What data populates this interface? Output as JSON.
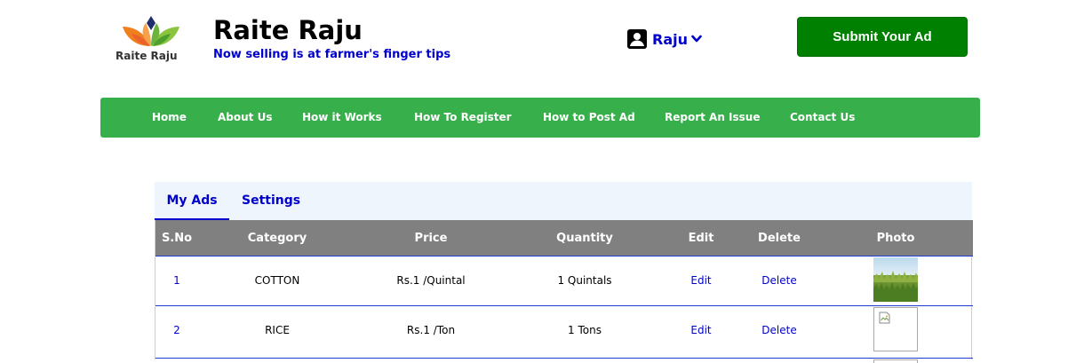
{
  "header": {
    "logo_text": "Raite Raju",
    "site_title": "Raite Raju",
    "tagline": "Now selling is at farmer's finger tips",
    "user_name": "Raju",
    "submit_label": "Submit Your Ad"
  },
  "nav": {
    "items": [
      "Home",
      "About Us",
      "How it Works",
      "How To Register",
      "How to Post Ad",
      "Report An Issue",
      "Contact Us"
    ]
  },
  "tabs": [
    "My Ads",
    "Settings"
  ],
  "table": {
    "headers": [
      "S.No",
      "Category",
      "Price",
      "Quantity",
      "Edit",
      "Delete",
      "Photo"
    ],
    "rows": [
      {
        "sno": "1",
        "category": "COTTON",
        "price": "Rs.1 /Quintal",
        "quantity": "1 Quintals",
        "edit": "Edit",
        "delete": "Delete",
        "photo": "crop-photo"
      },
      {
        "sno": "2",
        "category": "RICE",
        "price": "Rs.1 /Ton",
        "quantity": "1 Tons",
        "edit": "Edit",
        "delete": "Delete",
        "photo": "broken-image-icon"
      }
    ]
  },
  "colors": {
    "nav_green": "#37b04b",
    "button_green": "#008000",
    "link_blue": "#0000cc",
    "table_header_gray": "#808080",
    "tabs_bg": "#eef5fd"
  }
}
